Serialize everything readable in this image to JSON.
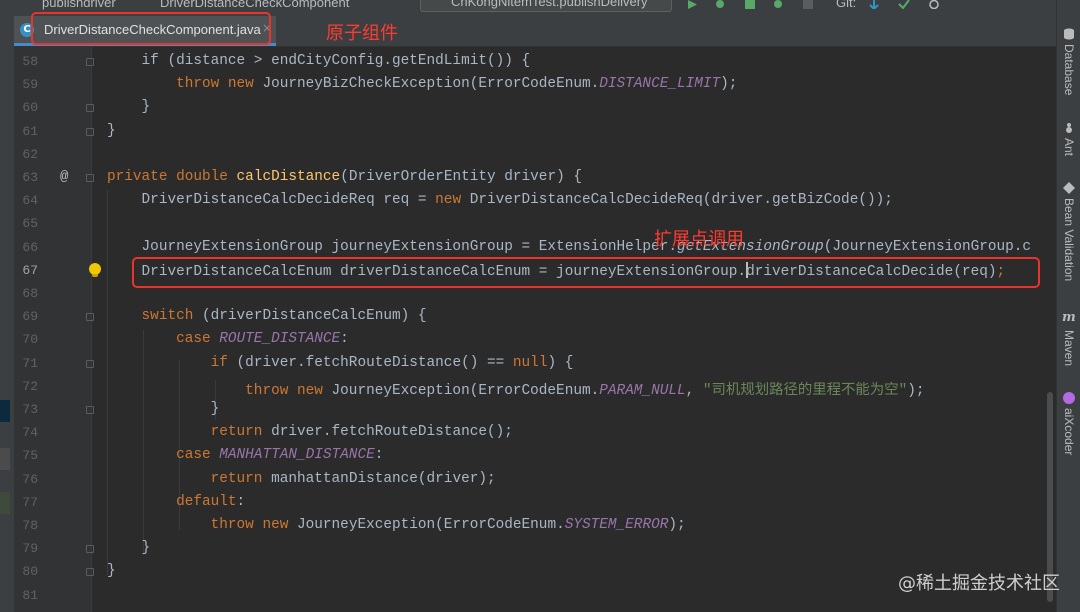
{
  "topbar": {
    "crumb_project": "publishdriver",
    "crumb_file": "DriverDistanceCheckComponent",
    "run_config": "CnKongNitemTest.publishDelivery",
    "git_label": "Git:"
  },
  "tab": {
    "filename": "DriverDistanceCheckComponent.java",
    "icon": "c-class-icon",
    "close": "×"
  },
  "annotations": {
    "atomic_component": "原子组件",
    "extension_call": "扩展点调用"
  },
  "editor": {
    "current_line": 67,
    "lines": [
      {
        "n": "58",
        "fold": true,
        "seg": [
          [
            "",
            12,
            "    if (distance > endCityConfig.getEndLimit()) {"
          ]
        ]
      },
      {
        "n": "59",
        "seg": [
          [
            "kw",
            0,
            "        throw new "
          ],
          [
            "",
            0,
            "JourneyBizCheckException(ErrorCodeEnum."
          ],
          [
            "cn",
            0,
            "DISTANCE_LIMIT"
          ],
          [
            "",
            0,
            ");"
          ]
        ]
      },
      {
        "n": "60",
        "fold": true,
        "seg": [
          [
            "",
            0,
            "    }"
          ]
        ]
      },
      {
        "n": "61",
        "fold": true,
        "seg": [
          [
            "",
            0,
            "}"
          ]
        ]
      },
      {
        "n": "62",
        "seg": []
      },
      {
        "n": "63",
        "at": true,
        "fold": true,
        "seg": [
          [
            "kw",
            0,
            "private double "
          ],
          [
            "fn",
            0,
            "calcDistance"
          ],
          [
            "",
            0,
            "(DriverOrderEntity driver) {"
          ]
        ]
      },
      {
        "n": "64",
        "seg": [
          [
            "",
            0,
            "    DriverDistanceCalcDecideReq req = "
          ],
          [
            "kw",
            0,
            "new "
          ],
          [
            "",
            0,
            "DriverDistanceCalcDecideReq(driver.getBizCode());"
          ]
        ]
      },
      {
        "n": "65",
        "seg": []
      },
      {
        "n": "66",
        "seg": [
          [
            "",
            0,
            "    JourneyExtensionGroup journeyExtensionGroup = ExtensionHelper."
          ],
          [
            "it",
            0,
            "getExtensionGroup"
          ],
          [
            "",
            0,
            "(JourneyExtensionGroup.c"
          ]
        ]
      },
      {
        "n": "67",
        "bulb": true,
        "seg": [
          [
            "",
            0,
            "    DriverDistanceCalcEnum driverDistanceCalcEnum = journeyExtensionGroup."
          ],
          [
            "caret",
            0,
            ""
          ],
          [
            "",
            0,
            "driverDistanceCalcDecide(req)"
          ],
          [
            "kw",
            0,
            ";"
          ]
        ]
      },
      {
        "n": "68",
        "seg": []
      },
      {
        "n": "69",
        "fold": true,
        "seg": [
          [
            "kw",
            0,
            "    switch "
          ],
          [
            "",
            0,
            "(driverDistanceCalcEnum) {"
          ]
        ]
      },
      {
        "n": "70",
        "seg": [
          [
            "kw",
            0,
            "        case "
          ],
          [
            "cn",
            0,
            "ROUTE_DISTANCE"
          ],
          [
            "",
            0,
            ":"
          ]
        ]
      },
      {
        "n": "71",
        "fold": true,
        "seg": [
          [
            "kw",
            0,
            "            if "
          ],
          [
            "",
            0,
            "(driver.fetchRouteDistance() == "
          ],
          [
            "kw",
            0,
            "null"
          ],
          [
            "",
            0,
            ") {"
          ]
        ]
      },
      {
        "n": "72",
        "seg": [
          [
            "kw",
            0,
            "                throw new "
          ],
          [
            "",
            0,
            "JourneyException(ErrorCodeEnum."
          ],
          [
            "cn",
            0,
            "PARAM_NULL"
          ],
          [
            "",
            0,
            ", "
          ],
          [
            "str",
            0,
            "\"司机规划路径的里程不能为空\""
          ],
          [
            "",
            0,
            ");"
          ]
        ]
      },
      {
        "n": "73",
        "fold": true,
        "seg": [
          [
            "",
            0,
            "            }"
          ]
        ]
      },
      {
        "n": "74",
        "seg": [
          [
            "kw",
            0,
            "            return "
          ],
          [
            "",
            0,
            "driver.fetchRouteDistance();"
          ]
        ]
      },
      {
        "n": "75",
        "seg": [
          [
            "kw",
            0,
            "        case "
          ],
          [
            "cn",
            0,
            "MANHATTAN_DISTANCE"
          ],
          [
            "",
            0,
            ":"
          ]
        ]
      },
      {
        "n": "76",
        "seg": [
          [
            "kw",
            0,
            "            return "
          ],
          [
            "",
            0,
            "manhattanDistance(driver);"
          ]
        ]
      },
      {
        "n": "77",
        "seg": [
          [
            "kw",
            0,
            "        default"
          ],
          [
            "",
            0,
            ":"
          ]
        ]
      },
      {
        "n": "78",
        "seg": [
          [
            "kw",
            0,
            "            throw new "
          ],
          [
            "",
            0,
            "JourneyException(ErrorCodeEnum."
          ],
          [
            "cn",
            0,
            "SYSTEM_ERROR"
          ],
          [
            "",
            0,
            ");"
          ]
        ]
      },
      {
        "n": "79",
        "fold": true,
        "seg": [
          [
            "",
            0,
            "    }"
          ]
        ]
      },
      {
        "n": "80",
        "fold": true,
        "seg": [
          [
            "",
            0,
            "}"
          ]
        ]
      },
      {
        "n": "81",
        "seg": []
      }
    ]
  },
  "right_tools": [
    {
      "label": "Database",
      "icon": "database-icon"
    },
    {
      "label": "Ant",
      "icon": "ant-icon"
    },
    {
      "label": "Bean Validation",
      "icon": "bean-validation-icon"
    },
    {
      "label": "Maven",
      "icon": "maven-icon"
    },
    {
      "label": "aiXcoder",
      "icon": "aixcoder-icon"
    }
  ],
  "watermark": "@稀土掘金技术社区"
}
